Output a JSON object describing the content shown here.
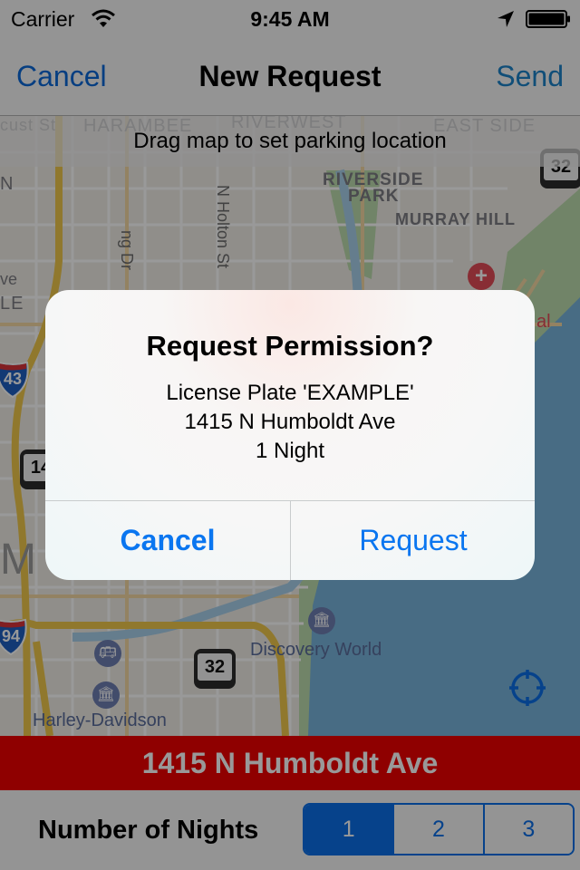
{
  "status_bar": {
    "carrier": "Carrier",
    "time": "9:45 AM",
    "icons": [
      "wifi-icon",
      "location-arrow-icon",
      "battery-icon"
    ]
  },
  "nav_bar": {
    "cancel_label": "Cancel",
    "title": "New Request",
    "send_label": "Send"
  },
  "map": {
    "hint": "Drag map to set parking location",
    "labels": {
      "locust": "cust St",
      "harambee": "HARAMBEE",
      "riverwest": "RIVERWEST",
      "east_side": "EAST SIDE",
      "n": "N",
      "riverside_park": "RIVERSIDE",
      "riverside_park2": "PARK",
      "murray_hill": "MURRAY HILL",
      "holton": "N Holton St",
      "king_dr": "ng Dr",
      "ave": "ve",
      "le": "LE",
      "hospital_al": "al",
      "big_m": "M",
      "discovery_world": "Discovery World",
      "harley": "Harley-Davidson"
    },
    "shields": {
      "route_32_top": "32",
      "route_14": "14",
      "route_32_bottom": "32",
      "interstate_43": "43",
      "interstate_94": "94"
    },
    "poi_icons": [
      "museum-icon",
      "bus-icon",
      "museum-icon",
      "hospital-icon"
    ]
  },
  "address_bar": {
    "text": "1415 N Humboldt Ave"
  },
  "bottom_panel": {
    "nights_label": "Number of Nights",
    "segments": [
      {
        "label": "1",
        "selected": true
      },
      {
        "label": "2",
        "selected": false
      },
      {
        "label": "3",
        "selected": false
      }
    ]
  },
  "alert": {
    "title": "Request Permission?",
    "message_lines": [
      "License Plate 'EXAMPLE'",
      "1415 N Humboldt Ave",
      "1 Night"
    ],
    "cancel_label": "Cancel",
    "request_label": "Request"
  },
  "colors": {
    "tint": "#0a6ee8",
    "address_bar": "#ee0000",
    "alert_button": "#0a76f0"
  }
}
